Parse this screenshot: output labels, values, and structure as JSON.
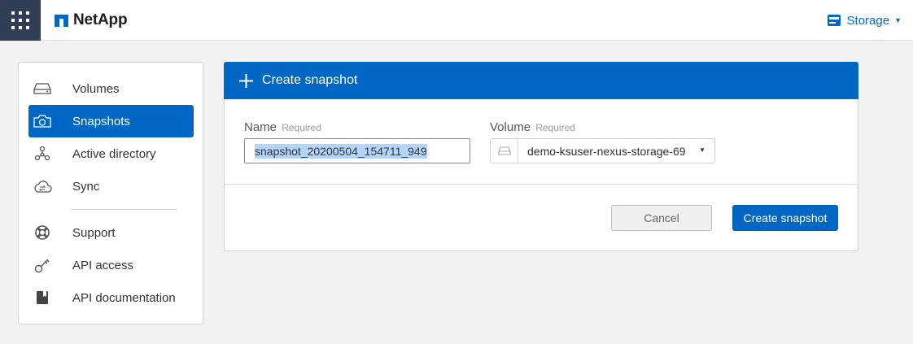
{
  "header": {
    "brand": "NetApp",
    "storage_menu_label": "Storage",
    "grid_icon": "apps-grid-icon",
    "storage_icon": "storage-icon"
  },
  "sidebar": {
    "items": [
      {
        "label": "Volumes",
        "icon": "drive-icon",
        "active": false
      },
      {
        "label": "Snapshots",
        "icon": "camera-icon",
        "active": true
      },
      {
        "label": "Active directory",
        "icon": "network-nodes-icon",
        "active": false
      },
      {
        "label": "Sync",
        "icon": "cloud-sync-icon",
        "active": false
      },
      {
        "label": "Support",
        "icon": "lifebuoy-icon",
        "active": false
      },
      {
        "label": "API access",
        "icon": "key-icon",
        "active": false
      },
      {
        "label": "API documentation",
        "icon": "book-icon",
        "active": false
      }
    ]
  },
  "panel": {
    "title": "Create snapshot",
    "name_field": {
      "label": "Name",
      "required_text": "Required",
      "value": "snapshot_20200504_154711_949"
    },
    "volume_field": {
      "label": "Volume",
      "required_text": "Required",
      "selected": "demo-ksuser-nexus-storage-69"
    },
    "cancel_label": "Cancel",
    "create_label": "Create snapshot"
  },
  "colors": {
    "accent": "#0067c5",
    "header_square": "#2f3e54",
    "background": "#f2f2f2"
  }
}
